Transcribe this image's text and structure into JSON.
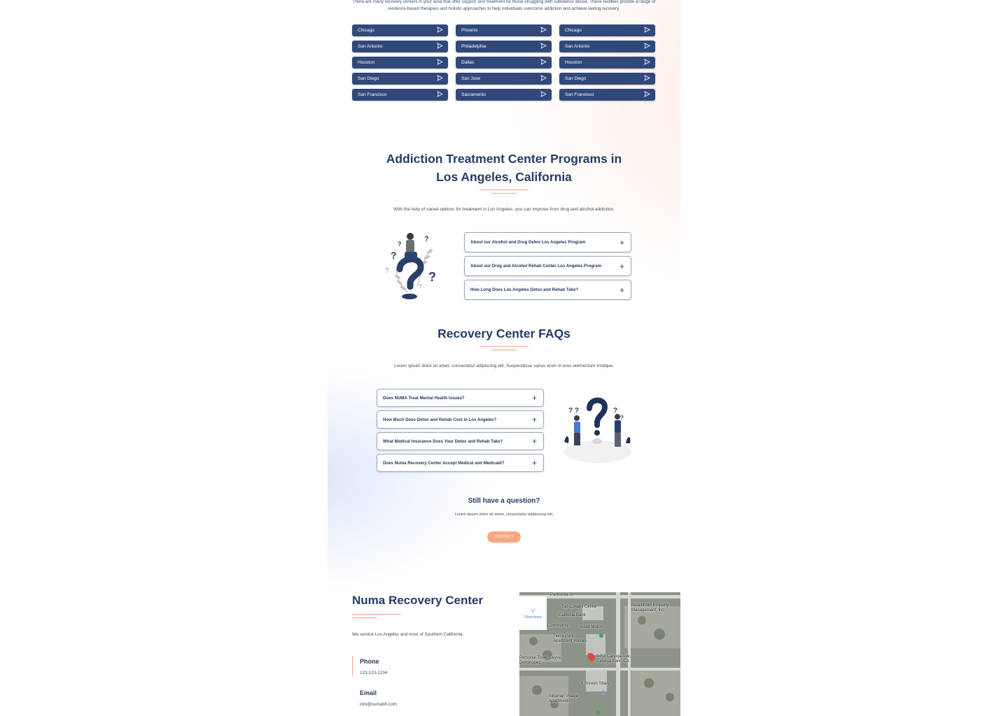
{
  "intro_text": "There are many recovery centers in your area that offer support and treatment for those struggling with substance abuse. These facilities provide a range of evidence-based therapies and holistic approaches to help individuals overcome addiction and achieve lasting recovery.",
  "cities": [
    "Chicago",
    "Phoenix",
    "Chicago",
    "San Antonio",
    "Philadelphia",
    "San Antonio",
    "Houston",
    "Dallas",
    "Houston",
    "San Diego",
    "San Jose",
    "San Diego",
    "San Francisco",
    "Sacramento",
    "San Francisco"
  ],
  "programs": {
    "title_line1": "Addiction Treatment Center Programs in",
    "title_line2": "Los Angeles, California",
    "subtitle": "With the help of varied options for treatment in Los Angeles, you can improve from drug and alcohol addiction.",
    "items": [
      "About our Alcohol and Drug Detox Los Angeles Program",
      "About our Drug and Alcohol Rehab Center Los Angeles Program",
      "How Long Does Los Angeles Detox and Rehab Take?"
    ]
  },
  "faqs": {
    "title": "Recovery Center FAQs",
    "subtitle": "Lorem ipsum dolor sit amet, consectetur adipiscing elit. Suspendisse varius enim in eros elementum tristique.",
    "items": [
      "Does NUMA Treat Mental Health Issues?",
      "How Much Does Detox and Rehab Cost in Los Angeles?",
      "What Medical Insurance Does Your Detox and Rehab Take?",
      "Does Numa Recovery Center Accept Medical and Medicaid?"
    ]
  },
  "question": {
    "title": "Still have a question?",
    "text": "Lorem ipsum dolor sit amet, consectetur adipiscing elit.",
    "button": "CONTACT"
  },
  "center": {
    "title": "Numa Recovery Center",
    "service": "We service Los Angeles and most of Southern California.",
    "phone_label": "Phone",
    "phone": "123-123-1234",
    "email_label": "Email",
    "email": "info@numabh.com"
  },
  "map": {
    "directions": "Directions",
    "labels": {
      "parthenia": "Parthenia St",
      "bosco": "Tab Collabs Center",
      "calnet": "Califonia Bank",
      "community": "Community",
      "arco": "Astell Motors",
      "tierra": "Tierra Park Apartment Homes",
      "personal": "Personal Tower Leyva Dominguez",
      "address1": "8453 Canoga Ave,",
      "address2": "Canoga Park, CA",
      "screen": "5 Screen Sharp",
      "village": "Intramar Village Apartments",
      "beach": "Beachfront Property Management, Inc."
    }
  }
}
